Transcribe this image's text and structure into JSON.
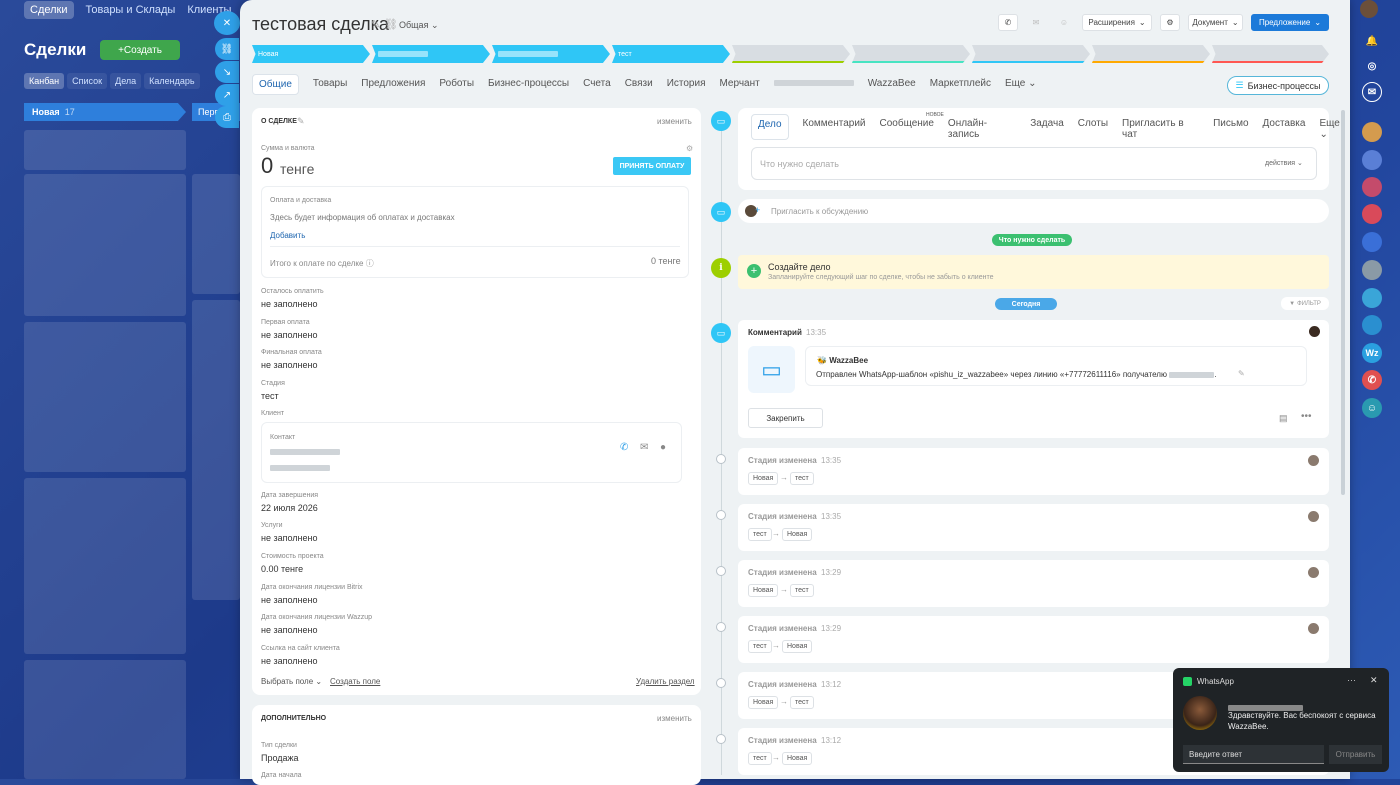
{
  "background": {
    "topnav": [
      "Сделки",
      "Товары и Склады",
      "Клиенты"
    ],
    "title": "Сделки",
    "create_label": "Создать",
    "views": [
      "Канбан",
      "Список",
      "Дела",
      "Календарь"
    ],
    "column_name": "Новая",
    "column_count": "17",
    "column2_name": "Перв"
  },
  "deal": {
    "title": "тестовая сделка",
    "category": "Общая",
    "header_buttons": {
      "extensions": "Расширения",
      "document": "Документ",
      "offer": "Предложение"
    },
    "stages": [
      {
        "label": "Новая",
        "color": "#2fc6f6"
      },
      {
        "label": "",
        "color": "#2fc6f6"
      },
      {
        "label": "",
        "color": "#2fc6f6"
      },
      {
        "label": "тест",
        "color": "#2fc6f6"
      }
    ],
    "tabs": [
      "Общие",
      "Товары",
      "Предложения",
      "Роботы",
      "Бизнес-процессы",
      "Счета",
      "Связи",
      "История",
      "Мерчант",
      "WazzaBee",
      "Маркетплейс",
      "Еще"
    ],
    "bp_button": "Бизнес-процессы"
  },
  "about": {
    "heading": "О СДЕЛКЕ",
    "edit_link": "изменить",
    "sum_label": "Сумма и валюта",
    "sum_value": "0",
    "currency": "тенге",
    "accept_payment": "ПРИНЯТЬ ОПЛАТУ",
    "payment_title": "Оплата и доставка",
    "payment_info": "Здесь будет информация об оплатах и доставках",
    "add_link": "Добавить",
    "total_label": "Итого к оплате по сделке",
    "total_value": "0 тенге",
    "fields": [
      {
        "label": "Осталось оплатить",
        "value": "не заполнено"
      },
      {
        "label": "Первая оплата",
        "value": "не заполнено"
      },
      {
        "label": "Финальная оплата",
        "value": "не заполнено"
      },
      {
        "label": "Стадия",
        "value": "тест"
      }
    ],
    "client_label": "Клиент",
    "contact_label": "Контакт",
    "fields2": [
      {
        "label": "Дата завершения",
        "value": "22 июля 2026"
      },
      {
        "label": "Услуги",
        "value": "не заполнено"
      },
      {
        "label": "Стоимость проекта",
        "value": "0.00 тенге"
      },
      {
        "label": "Дата окончания лицензии Bitrix",
        "value": "не заполнено"
      },
      {
        "label": "Дата окончания лицензии Wazzup",
        "value": "не заполнено"
      },
      {
        "label": "Ссылка на сайт клиента",
        "value": "не заполнено"
      }
    ],
    "choose_field": "Выбрать поле",
    "create_field": "Создать поле",
    "delete_section": "Удалить раздел"
  },
  "extra": {
    "heading": "ДОПОЛНИТЕЛЬНО",
    "edit_link": "изменить",
    "type_label": "Тип сделки",
    "type_value": "Продажа",
    "start_label": "Дата начала"
  },
  "activity": {
    "tabs": [
      "Дело",
      "Комментарий",
      "Сообщение",
      "Онлайн-запись",
      "Задача",
      "Слоты",
      "Пригласить в чат",
      "Письмо",
      "Доставка",
      "Еще"
    ],
    "new_badge": "НОВОЕ",
    "placeholder": "Что нужно сделать",
    "actions": "действия",
    "discuss_placeholder": "Пригласить к обсуждению",
    "todo_pill": "Что нужно сделать",
    "create_task_title": "Создайте дело",
    "create_task_sub": "Запланируйте следующий шаг по сделке, чтобы не забыть о клиенте",
    "today_pill": "Сегодня",
    "filter": "ФИЛЬТР"
  },
  "comment": {
    "title": "Комментарий",
    "time": "13:35",
    "app": "WazzaBee",
    "text": "Отправлен WhatsApp-шаблон «pishu_iz_wazzabee» через линию «+77772611116» получателю",
    "pin": "Закрепить"
  },
  "stage_changes": [
    {
      "title": "Стадия изменена",
      "time": "13:35",
      "from": "Новая",
      "to": "тест"
    },
    {
      "title": "Стадия изменена",
      "time": "13:35",
      "from": "тест",
      "to": "Новая"
    },
    {
      "title": "Стадия изменена",
      "time": "13:29",
      "from": "Новая",
      "to": "тест"
    },
    {
      "title": "Стадия изменена",
      "time": "13:29",
      "from": "тест",
      "to": "Новая"
    },
    {
      "title": "Стадия изменена",
      "time": "13:12",
      "from": "Новая",
      "to": "тест"
    },
    {
      "title": "Стадия изменена",
      "time": "13:12",
      "from": "тест",
      "to": "Новая"
    }
  ],
  "toast": {
    "app": "WhatsApp",
    "message": "Здравствуйте. Вас беспокоят с сервиса WazzaBee.",
    "input_placeholder": "Введите ответ",
    "send": "Отправить"
  },
  "colors": {
    "accent": "#2fc6f6",
    "link": "#2067b0",
    "green": "#9dcf00"
  }
}
